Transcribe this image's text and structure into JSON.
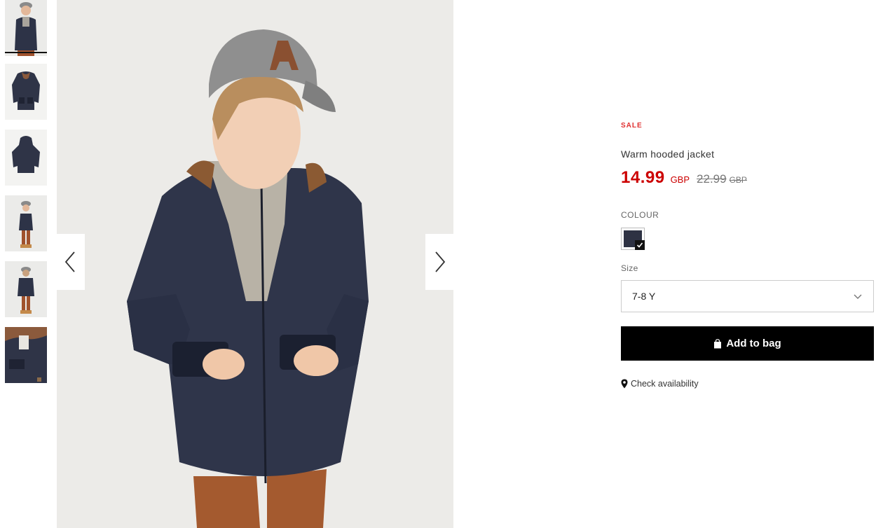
{
  "gallery": {
    "thumbnails": [
      {
        "alt": "model-front-icon"
      },
      {
        "alt": "jacket-flat-front-icon"
      },
      {
        "alt": "jacket-flat-back-icon"
      },
      {
        "alt": "model-side-icon"
      },
      {
        "alt": "model-back-icon"
      },
      {
        "alt": "jacket-detail-icon"
      }
    ],
    "prev_icon": "chevron-left-icon",
    "next_icon": "chevron-right-icon"
  },
  "product": {
    "sale_tag": "SALE",
    "title": "Warm hooded jacket",
    "price_now": "14.99",
    "currency_now": "GBP",
    "price_old": "22.99",
    "currency_old": "GBP",
    "colour_label": "COLOUR",
    "colour_swatch": "#2e3243",
    "size_label": "Size",
    "size_value": "7-8 Y",
    "add_to_bag": "Add to bag",
    "check_availability": "Check availability"
  },
  "colors": {
    "sale": "#e03131",
    "price": "#cc0000",
    "button": "#000000"
  }
}
